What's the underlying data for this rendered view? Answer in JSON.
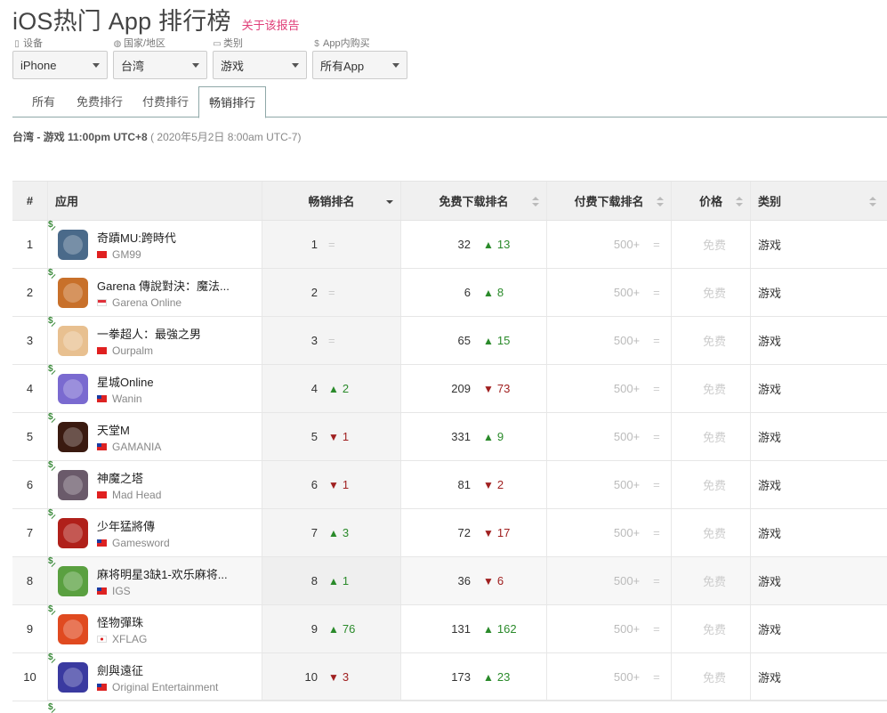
{
  "header": {
    "title": "iOS热门 App 排行榜",
    "report_link": "关于该报告"
  },
  "filters": [
    {
      "label": "设备",
      "icon": "device-icon",
      "value": "iPhone"
    },
    {
      "label": "国家/地区",
      "icon": "globe-icon",
      "value": "台湾"
    },
    {
      "label": "类别",
      "icon": "folder-icon",
      "value": "游戏"
    },
    {
      "label": "App内购买",
      "icon": "dollar-icon",
      "value": "所有App"
    }
  ],
  "tabs": [
    {
      "label": "所有",
      "active": false
    },
    {
      "label": "免费排行",
      "active": false
    },
    {
      "label": "付费排行",
      "active": false
    },
    {
      "label": "畅销排行",
      "active": true
    }
  ],
  "subtitle": {
    "bold": "台湾 - 游戏 11:00pm",
    "tz": "UTC+8",
    "muted": "( 2020年5月2日 8:00am UTC-7)"
  },
  "table": {
    "headers": {
      "idx": "#",
      "app": "应用",
      "gross": "畅销排名",
      "free": "免费下载排名",
      "paid": "付费下载排名",
      "price": "价格",
      "category": "类别"
    },
    "iap_mark": "$",
    "rows": [
      {
        "idx": "1",
        "name": "奇蹟MU:跨時代",
        "publisher": "GM99",
        "flag": "cn",
        "icon_color": "#4a6a8a",
        "gross": "1",
        "gross_chg": "=",
        "gross_dir": "eq",
        "free": "32",
        "free_chg": "13",
        "free_dir": "up",
        "paid": "500+",
        "paid_chg": "=",
        "price": "免费",
        "category": "游戏"
      },
      {
        "idx": "2",
        "name": "Garena 傳說對決：魔法...",
        "publisher": "Garena Online",
        "flag": "sg",
        "icon_color": "#c8702a",
        "gross": "2",
        "gross_chg": "=",
        "gross_dir": "eq",
        "free": "6",
        "free_chg": "8",
        "free_dir": "up",
        "paid": "500+",
        "paid_chg": "=",
        "price": "免费",
        "category": "游戏"
      },
      {
        "idx": "3",
        "name": "一拳超人：最強之男",
        "publisher": "Ourpalm",
        "flag": "cn",
        "icon_color": "#e8c090",
        "gross": "3",
        "gross_chg": "=",
        "gross_dir": "eq",
        "free": "65",
        "free_chg": "15",
        "free_dir": "up",
        "paid": "500+",
        "paid_chg": "=",
        "price": "免费",
        "category": "游戏"
      },
      {
        "idx": "4",
        "name": "星城Online",
        "publisher": "Wanin",
        "flag": "tw",
        "icon_color": "#7a6ad0",
        "gross": "4",
        "gross_chg": "2",
        "gross_dir": "up",
        "free": "209",
        "free_chg": "73",
        "free_dir": "down",
        "paid": "500+",
        "paid_chg": "=",
        "price": "免费",
        "category": "游戏"
      },
      {
        "idx": "5",
        "name": "天堂M",
        "publisher": "GAMANIA",
        "flag": "tw",
        "icon_color": "#3a1a10",
        "gross": "5",
        "gross_chg": "1",
        "gross_dir": "down",
        "free": "331",
        "free_chg": "9",
        "free_dir": "up",
        "paid": "500+",
        "paid_chg": "=",
        "price": "免费",
        "category": "游戏"
      },
      {
        "idx": "6",
        "name": "神魔之塔",
        "publisher": "Mad Head",
        "flag": "hk",
        "icon_color": "#6a5a6a",
        "gross": "6",
        "gross_chg": "1",
        "gross_dir": "down",
        "free": "81",
        "free_chg": "2",
        "free_dir": "down",
        "paid": "500+",
        "paid_chg": "=",
        "price": "免费",
        "category": "游戏"
      },
      {
        "idx": "7",
        "name": "少年猛將傳",
        "publisher": "Gamesword",
        "flag": "tw",
        "icon_color": "#b0201a",
        "gross": "7",
        "gross_chg": "3",
        "gross_dir": "up",
        "free": "72",
        "free_chg": "17",
        "free_dir": "down",
        "paid": "500+",
        "paid_chg": "=",
        "price": "免费",
        "category": "游戏"
      },
      {
        "idx": "8",
        "name": "麻将明星3缺1-欢乐麻将...",
        "publisher": "IGS",
        "flag": "tw",
        "icon_color": "#5aa040",
        "gross": "8",
        "gross_chg": "1",
        "gross_dir": "up",
        "free": "36",
        "free_chg": "6",
        "free_dir": "down",
        "paid": "500+",
        "paid_chg": "=",
        "price": "免费",
        "category": "游戏",
        "highlight": true
      },
      {
        "idx": "9",
        "name": "怪物彈珠",
        "publisher": "XFLAG",
        "flag": "jp",
        "icon_color": "#e04a20",
        "gross": "9",
        "gross_chg": "76",
        "gross_dir": "up",
        "free": "131",
        "free_chg": "162",
        "free_dir": "up",
        "paid": "500+",
        "paid_chg": "=",
        "price": "免费",
        "category": "游戏"
      },
      {
        "idx": "10",
        "name": "劍與遠征",
        "publisher": "Original Entertainment",
        "flag": "tw",
        "icon_color": "#3a3aa0",
        "gross": "10",
        "gross_chg": "3",
        "gross_dir": "down",
        "free": "173",
        "free_chg": "23",
        "free_dir": "up",
        "paid": "500+",
        "paid_chg": "=",
        "price": "免费",
        "category": "游戏"
      }
    ]
  }
}
